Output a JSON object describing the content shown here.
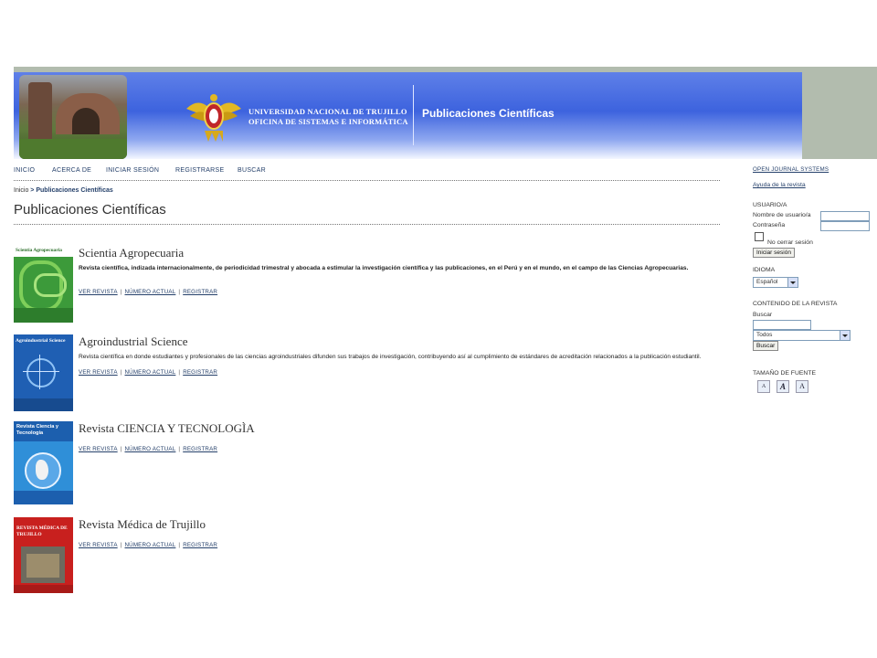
{
  "header": {
    "university_line1": "UNIVERSIDAD NACIONAL DE TRUJILLO",
    "university_line2": "OFICINA DE SISTEMAS E INFORMÁTICA",
    "site_title": "Publicaciones Científicas"
  },
  "nav": {
    "items": [
      "INICIO",
      "ACERCA DE",
      "INICIAR SESIÓN",
      "REGISTRARSE",
      "BUSCAR"
    ]
  },
  "breadcrumb": {
    "home": "Inicio",
    "separator": ">",
    "current": "Publicaciones Científicas"
  },
  "page_title": "Publicaciones Científicas",
  "journals": [
    {
      "title": "Scientia Agropecuaria",
      "cover_text": "Scientia Agropecuaria",
      "description": "Revista científica, indizada internacionalmente, de periodicidad trimestral y  abocada a estimular la investigación científica y las publicaciones, en el Perú y en el mundo, en el campo de las Ciencias Agropecuarias.",
      "links": [
        "VER REVISTA",
        "NÚMERO ACTUAL",
        "REGISTRAR"
      ]
    },
    {
      "title": "Agroindustrial Science",
      "cover_text": "Agroindustrial Science",
      "description": "Revista científica en donde estudiantes y profesionales de las ciencias agroindustriales difunden sus trabajos de investigación, contribuyendo así al cumplimiento de estándares de acreditación relacionados a la publicación estudiantil.",
      "links": [
        "VER REVISTA",
        "NÚMERO ACTUAL",
        "REGISTRAR"
      ]
    },
    {
      "title": "Revista CIENCIA Y TECNOLOGÌA",
      "cover_text": "Revista Ciencia y Tecnología",
      "description": "",
      "links": [
        "VER REVISTA",
        "NÚMERO ACTUAL",
        "REGISTRAR"
      ]
    },
    {
      "title": "Revista Médica de Trujillo",
      "cover_text": "REVISTA MÉDICA DE TRUJILLO",
      "description": "",
      "links": [
        "VER REVISTA",
        "NÚMERO ACTUAL",
        "REGISTRAR"
      ]
    }
  ],
  "sidebar": {
    "ojs_link": "OPEN JOURNAL SYSTEMS",
    "help_link": "Ayuda de la revista",
    "user_heading": "USUARIO/A",
    "username_label": "Nombre de usuario/a",
    "password_label": "Contraseña",
    "remember_label": "No cerrar sesión",
    "login_button": "Iniciar sesión",
    "language_heading": "IDIOMA",
    "language_value": "Español",
    "content_heading": "CONTENIDO DE LA REVISTA",
    "search_label": "Buscar",
    "search_scope": "Todos",
    "search_button": "Buscar",
    "font_heading": "TAMAÑO DE FUENTE",
    "font_small": "A",
    "font_medium": "A",
    "font_large": "A"
  },
  "colors": {
    "banner_blue": "#3d63de",
    "frame_gray": "#b2bcae",
    "link_blue": "#26416b"
  }
}
